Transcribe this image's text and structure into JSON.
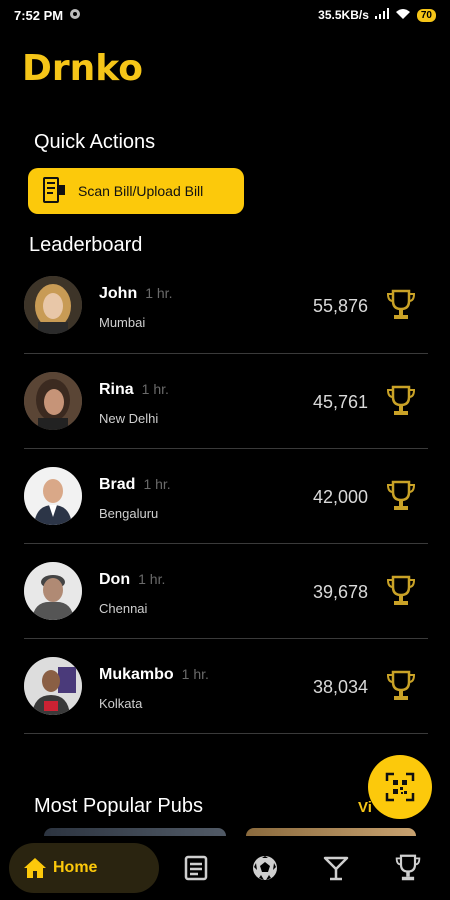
{
  "status": {
    "time": "7:52 PM",
    "speed": "35.5KB/s",
    "battery": "70"
  },
  "app": {
    "logo": "Drnko"
  },
  "quick_actions": {
    "title": "Quick Actions",
    "scan_label": "Scan Bill/Upload Bill"
  },
  "leaderboard": {
    "title": "Leaderboard",
    "rows": [
      {
        "name": "John",
        "time": "1 hr.",
        "city": "Mumbai",
        "score": "55,876"
      },
      {
        "name": "Rina",
        "time": "1 hr.",
        "city": "New Delhi",
        "score": "45,761"
      },
      {
        "name": "Brad",
        "time": "1 hr.",
        "city": "Bengaluru",
        "score": "42,000"
      },
      {
        "name": "Don",
        "time": "1 hr.",
        "city": "Chennai",
        "score": "39,678"
      },
      {
        "name": "Mukambo",
        "time": "1 hr.",
        "city": "Kolkata",
        "score": "38,034"
      }
    ]
  },
  "pubs": {
    "title": "Most Popular Pubs",
    "view_all": "Vi"
  },
  "nav": {
    "home_label": "Home",
    "icons": [
      "list-icon",
      "soccer-ball-icon",
      "cocktail-icon",
      "trophy-icon"
    ]
  },
  "colors": {
    "accent": "#fcc90b",
    "background": "#000000",
    "divider": "#3a3a3a"
  }
}
